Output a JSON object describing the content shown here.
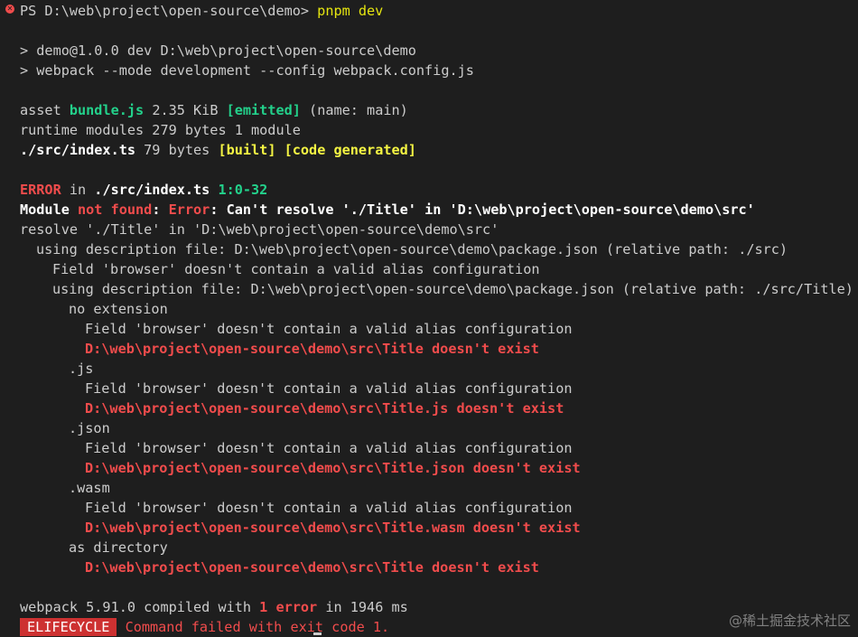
{
  "prompt": {
    "text": "PS D:\\web\\project\\open-source\\demo> ",
    "command": "pnpm dev",
    "status_icon": "error-circle-icon"
  },
  "script_lines": [
    "> demo@1.0.0 dev D:\\web\\project\\open-source\\demo",
    "> webpack --mode development --config webpack.config.js"
  ],
  "asset": {
    "prefix": "asset ",
    "name": "bundle.js",
    "size": " 2.35 KiB ",
    "emitted": "[emitted]",
    "suffix": " (name: main)"
  },
  "runtime_line": "runtime modules 279 bytes 1 module",
  "module_line": {
    "path": "./src/index.ts",
    "size": " 79 bytes ",
    "built": "[built]",
    "generated": "[code generated]"
  },
  "error_header": {
    "label": "ERROR",
    "in": " in ",
    "file": "./src/index.ts",
    "loc": "1:0-32"
  },
  "module_not_found": {
    "module": "Module ",
    "not_found": "not found",
    "colon": ": ",
    "error": "Error",
    "message": ": Can't resolve './Title' in 'D:\\web\\project\\open-source\\demo\\src'"
  },
  "resolve_lines": [
    {
      "indent": 0,
      "text": "resolve './Title' in 'D:\\web\\project\\open-source\\demo\\src'",
      "kind": "plain"
    },
    {
      "indent": 1,
      "text": "using description file: D:\\web\\project\\open-source\\demo\\package.json (relative path: ./src)",
      "kind": "plain"
    },
    {
      "indent": 2,
      "text": "Field 'browser' doesn't contain a valid alias configuration",
      "kind": "plain"
    },
    {
      "indent": 2,
      "text": "using description file: D:\\web\\project\\open-source\\demo\\package.json (relative path: ./src/Title)",
      "kind": "plain"
    },
    {
      "indent": 3,
      "text": "no extension",
      "kind": "plain"
    },
    {
      "indent": 4,
      "text": "Field 'browser' doesn't contain a valid alias configuration",
      "kind": "plain"
    },
    {
      "indent": 4,
      "text": "D:\\web\\project\\open-source\\demo\\src\\Title doesn't exist",
      "kind": "error"
    },
    {
      "indent": 3,
      "text": ".js",
      "kind": "plain"
    },
    {
      "indent": 4,
      "text": "Field 'browser' doesn't contain a valid alias configuration",
      "kind": "plain"
    },
    {
      "indent": 4,
      "text": "D:\\web\\project\\open-source\\demo\\src\\Title.js doesn't exist",
      "kind": "error"
    },
    {
      "indent": 3,
      "text": ".json",
      "kind": "plain"
    },
    {
      "indent": 4,
      "text": "Field 'browser' doesn't contain a valid alias configuration",
      "kind": "plain"
    },
    {
      "indent": 4,
      "text": "D:\\web\\project\\open-source\\demo\\src\\Title.json doesn't exist",
      "kind": "error"
    },
    {
      "indent": 3,
      "text": ".wasm",
      "kind": "plain"
    },
    {
      "indent": 4,
      "text": "Field 'browser' doesn't contain a valid alias configuration",
      "kind": "plain"
    },
    {
      "indent": 4,
      "text": "D:\\web\\project\\open-source\\demo\\src\\Title.wasm doesn't exist",
      "kind": "error"
    },
    {
      "indent": 3,
      "text": "as directory",
      "kind": "plain"
    },
    {
      "indent": 4,
      "text": "D:\\web\\project\\open-source\\demo\\src\\Title doesn't exist",
      "kind": "error"
    }
  ],
  "summary": {
    "prefix": "webpack 5.91.0 compiled with ",
    "errors": "1 error",
    "suffix": " in 1946 ms"
  },
  "lifecycle": {
    "badge": "ELIFECYCLE",
    "message": " Command failed with exit code 1."
  },
  "watermark": "@稀土掘金技术社区",
  "colors": {
    "background": "#1e1e1e",
    "text": "#cccccc",
    "green": "#23d18b",
    "yellow": "#f5f543",
    "red": "#f14c4c",
    "badge_red": "#cd3131"
  }
}
